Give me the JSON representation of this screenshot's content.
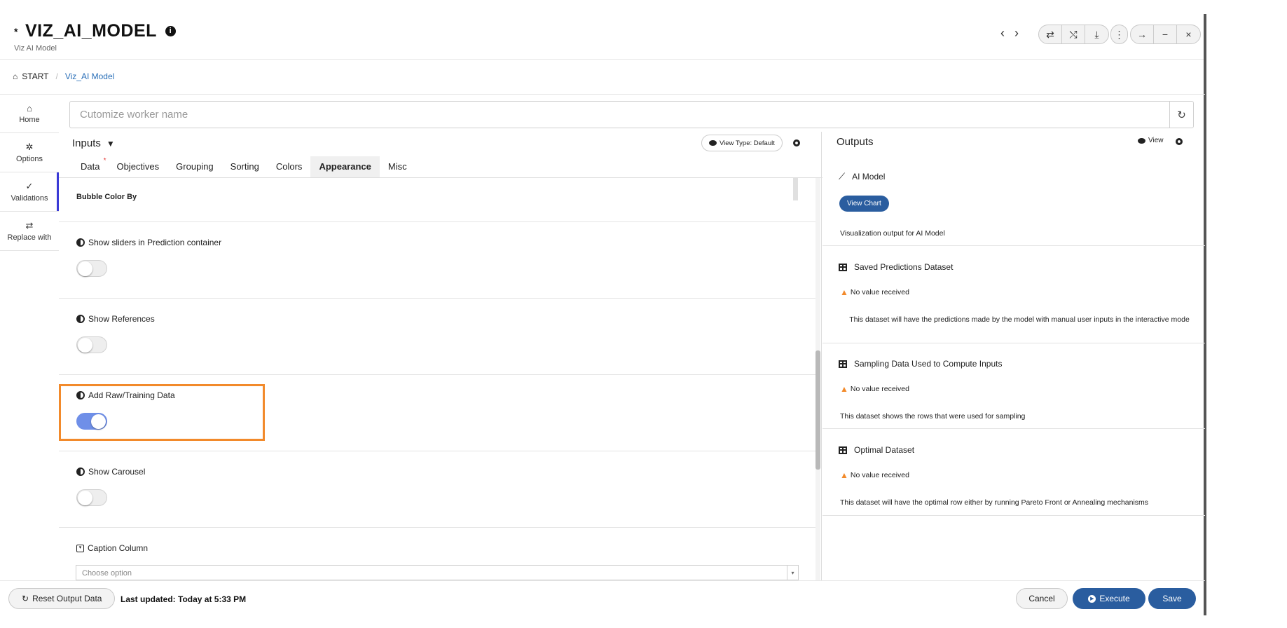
{
  "header": {
    "star": "*",
    "title": "VIZ_AI_MODEL",
    "info_icon": "info-icon",
    "subtitle": "Viz AI Model",
    "nav": [
      "‹",
      "›"
    ],
    "group1": [
      "⇄",
      "⤭",
      "⤓"
    ],
    "group2": [
      "⋮"
    ],
    "group3": [
      "→",
      "−",
      "×"
    ]
  },
  "breadcrumb": {
    "home": "START",
    "current": "Viz_AI Model"
  },
  "leftnav": [
    {
      "icon": "home-icon",
      "glyph": "⌂",
      "label": "Home"
    },
    {
      "icon": "gear-icon",
      "glyph": "✲",
      "label": "Options"
    },
    {
      "icon": "check-icon",
      "glyph": "✓",
      "label": "Validations"
    },
    {
      "icon": "swap-icon",
      "glyph": "⇄",
      "label": "Replace with"
    }
  ],
  "worker": {
    "placeholder": "Cutomize worker name"
  },
  "inputs": {
    "title": "Inputs",
    "filter": "▼",
    "view_type": "View Type: Default",
    "tabs": [
      "Data",
      "Objectives",
      "Grouping",
      "Sorting",
      "Colors",
      "Appearance",
      "Misc"
    ],
    "required_mark": "*",
    "active_tab": "Appearance",
    "bubble_color_by": "Bubble Color By",
    "sections": [
      {
        "label": "Show sliders in Prediction container",
        "on": false
      },
      {
        "label": "Show References",
        "on": false
      },
      {
        "label": "Add Raw/Training Data",
        "on": true
      },
      {
        "label": "Show Carousel",
        "on": false
      }
    ],
    "caption_column": "Caption Column",
    "caption_placeholder": "Choose option"
  },
  "outputs": {
    "title": "Outputs",
    "view": "View",
    "ai_model": "AI Model",
    "view_chart": "View Chart",
    "ai_model_desc": "Visualization output for AI Model",
    "no_value": "No value received",
    "datasets": [
      {
        "name": "Saved Predictions Dataset",
        "desc": "This dataset will have the predictions made by the model with manual user inputs in the interactive mode"
      },
      {
        "name": "Sampling Data Used to Compute Inputs",
        "desc": "This dataset shows the rows that were used for sampling"
      },
      {
        "name": "Optimal Dataset",
        "desc": "This dataset will have the optimal row either by running Pareto Front or Annealing mechanisms"
      }
    ]
  },
  "footer": {
    "reset": "Reset Output Data",
    "last_updated": "Last updated: Today at 5:33 PM",
    "cancel": "Cancel",
    "execute": "Execute",
    "save": "Save"
  }
}
